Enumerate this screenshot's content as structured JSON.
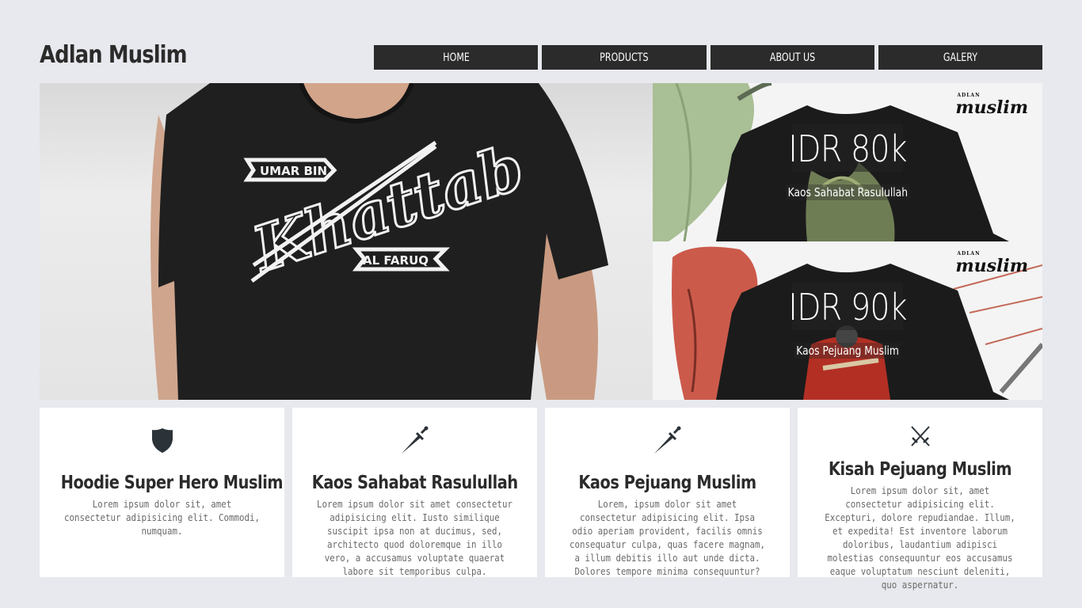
{
  "brand": {
    "title": "Adlan Muslim"
  },
  "nav": {
    "items": [
      {
        "label": "HOME"
      },
      {
        "label": "PRODUCTS"
      },
      {
        "label": "ABOUT US"
      },
      {
        "label": "GALERY"
      }
    ]
  },
  "hero": {
    "shirt_text_top": "UMAR BIN",
    "shirt_text_main": "Khattab",
    "shirt_text_bottom": "AL FARUQ"
  },
  "side_products": [
    {
      "price": "IDR 80k",
      "name": "Kaos Sahabat Rasulullah",
      "logo": "muslim",
      "logo_small": "ADLAN"
    },
    {
      "price": "IDR 90k",
      "name": "Kaos Pejuang Muslim",
      "logo": "muslim",
      "logo_small": "ADLAN"
    }
  ],
  "cards": [
    {
      "icon": "shield-icon",
      "title": "Hoodie Super Hero Muslim",
      "text": "Lorem ipsum dolor sit, amet consectetur adipisicing elit. Commodi, numquam."
    },
    {
      "icon": "dagger-icon",
      "title": "Kaos Sahabat Rasulullah",
      "text": "Lorem ipsum dolor sit amet consectetur adipisicing elit. Iusto similique suscipit ipsa non at ducimus, sed, architecto quod doloremque in illo vero, a accusamus voluptate quaerat labore sit temporibus culpa."
    },
    {
      "icon": "dagger-icon",
      "title": "Kaos Pejuang Muslim",
      "text": "Lorem, ipsum dolor sit amet consectetur adipisicing elit. Ipsa odio aperiam provident, facilis omnis consequatur culpa, quas facere magnam, a illum debitis illo aut unde dicta. Dolores tempore minima consequuntur?"
    },
    {
      "icon": "crossed-swords-icon",
      "title": "Kisah Pejuang Muslim",
      "text": "Lorem ipsum dolor sit, amet consectetur adipisicing elit. Excepturi, dolore repudiandae. Illum, et expedita! Est inventore laborum doloribus, laudantium adipisci molestias consequuntur eos accusamus eaque voluptatum nesciunt deleniti, quo aspernatur."
    }
  ],
  "colors": {
    "background": "#e8e9ee",
    "dark": "#2b2b2b",
    "card": "#ffffff"
  }
}
